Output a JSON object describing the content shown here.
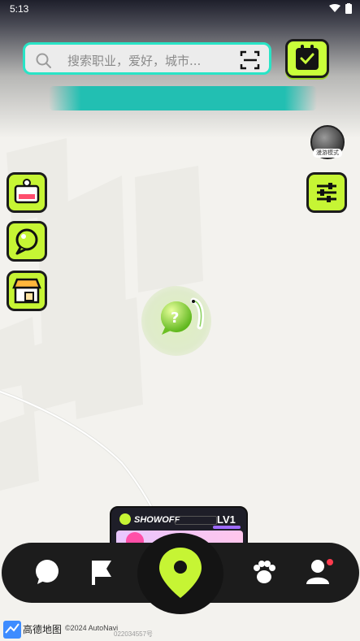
{
  "status_bar": {
    "time": "5:13"
  },
  "search": {
    "placeholder": "搜索职业，爱好，城市..."
  },
  "mode_toggle": {
    "label": "漫游模式"
  },
  "card": {
    "name": "SHOWOFF",
    "level": "LV1"
  },
  "map_attribution": {
    "brand": "高德地图",
    "copyright": "©2024 AutoNavi",
    "license": "022034557号"
  },
  "colors": {
    "accent_lime": "#c6f534",
    "accent_teal": "#22bfb2",
    "nav_bg": "#1c1c1c"
  },
  "icons": {
    "search": "search-icon",
    "scan": "scan-icon",
    "calendar": "calendar-check-icon",
    "profile_card": "id-card-icon",
    "chat": "chat-bubble-icon",
    "shop": "shop-icon",
    "filter": "sliders-icon",
    "messages": "message-icon",
    "flag": "flag-icon",
    "location": "location-pin-icon",
    "pets": "paw-icon",
    "user": "user-icon"
  }
}
